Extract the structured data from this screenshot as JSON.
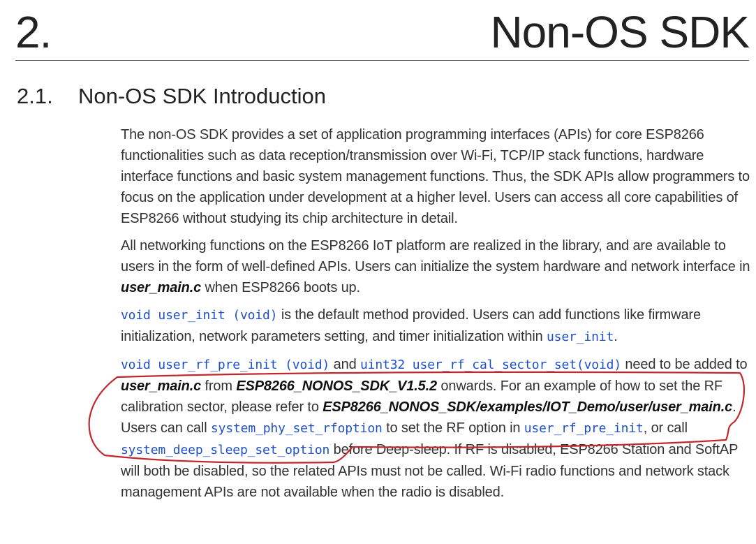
{
  "chapter": {
    "number": "2.",
    "title": "Non-OS SDK"
  },
  "section": {
    "number": "2.1.",
    "title": "Non-OS SDK Introduction"
  },
  "paragraphs": {
    "p1": "The non-OS SDK provides a set of application programming interfaces (APIs) for core ESP8266 functionalities such as data reception/transmission over Wi-Fi, TCP/IP stack functions, hardware interface functions and basic system management functions. Thus, the SDK APIs allow programmers to focus on the application under development at a higher level. Users can access all core capabilities of ESP8266 without studying its chip architecture in detail.",
    "p2": {
      "text_a": "All networking functions on the ESP8266 IoT platform are realized in the library, and are available to users in the form of well-defined APIs. Users can initialize the system hardware and network interface in ",
      "file": "user_main.c",
      "text_b": " when ESP8266 boots up."
    },
    "p3": {
      "code_a": "void user_init (void)",
      "text_a": " is the default method provided. Users can add functions like firmware initialization, network parameters setting, and timer initialization within ",
      "code_b": "user_init",
      "text_b": "."
    },
    "p4": {
      "code_a": "void user_rf_pre_init (void)",
      "text_a": " and ",
      "code_b": "uint32 user_rf_cal_sector_set(void)",
      "text_b": " need to be added to ",
      "file_a": "user_main.c",
      "text_c": " from ",
      "version": "ESP8266_NONOS_SDK_V1.5.2",
      "text_d": " onwards. For an example of how to set the RF calibration sector, please refer to ",
      "path": "ESP8266_NONOS_SDK/examples/IOT_Demo/user/user_main.c",
      "text_e": ". Users can call ",
      "code_c": "system_phy_set_rfoption",
      "text_f": " to set the RF option in ",
      "code_d": "user_rf_pre_init",
      "text_g": ", or call ",
      "code_e": "system_deep_sleep_set_option",
      "text_h": " before Deep-sleep. If RF is disabled, ESP8266 Station and SoftAP will both be disabled, so the related APIs must not be called. Wi-Fi radio functions and network stack management APIs are not available when the radio is disabled."
    }
  },
  "colors": {
    "code": "#1e50c8",
    "annotation": "#c0282d"
  }
}
